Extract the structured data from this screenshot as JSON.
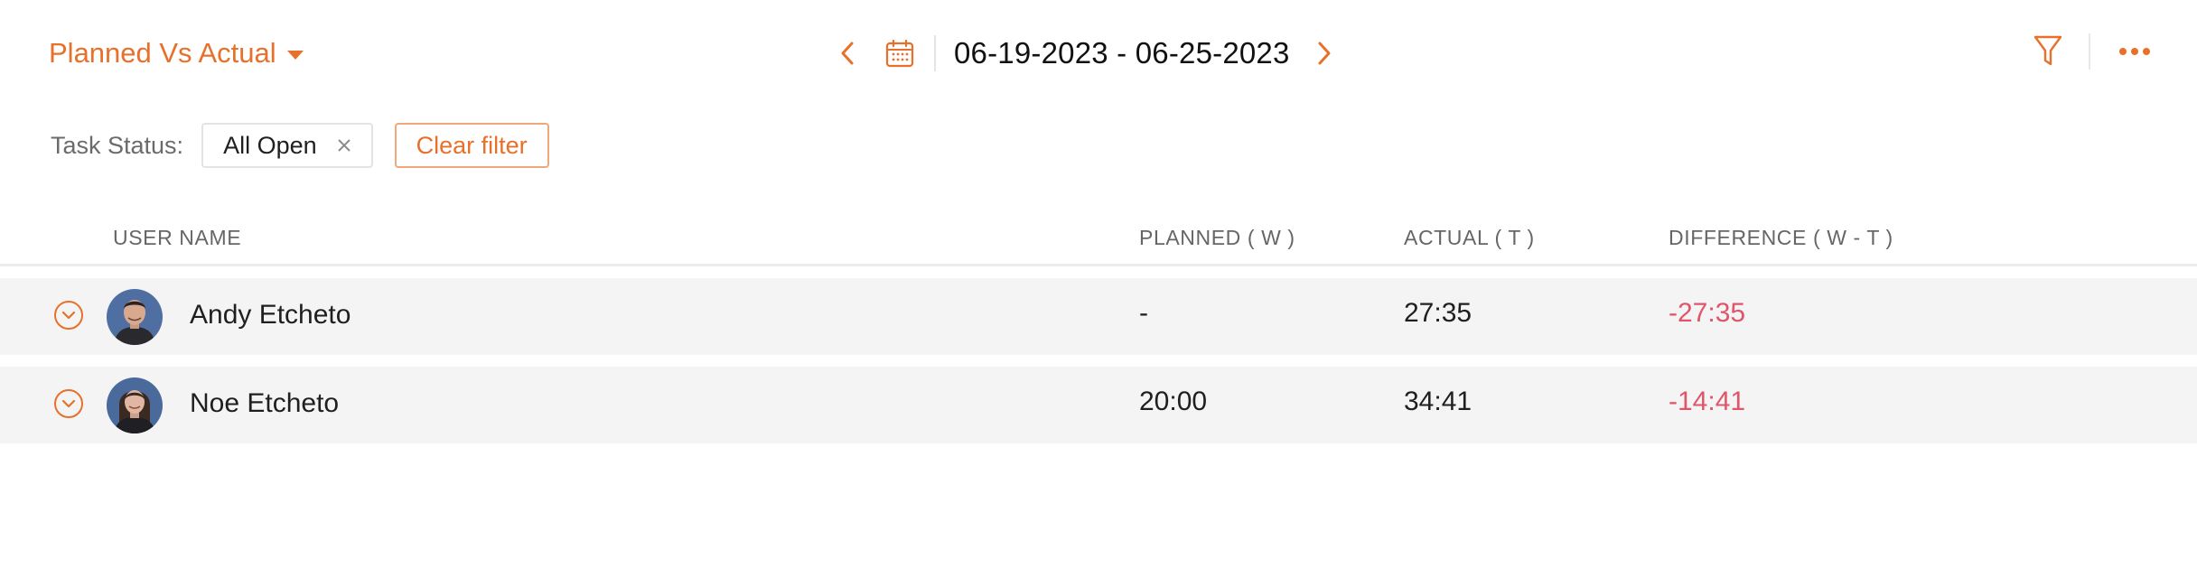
{
  "header": {
    "view_label": "Planned Vs Actual",
    "date_range": "06-19-2023 - 06-25-2023"
  },
  "filters": {
    "label": "Task Status:",
    "chips": [
      {
        "label": "All Open"
      }
    ],
    "clear_label": "Clear filter"
  },
  "table": {
    "columns": {
      "user_name": "USER NAME",
      "planned": "PLANNED ( W )",
      "actual": "ACTUAL ( T )",
      "difference": "DIFFERENCE ( W - T )"
    },
    "rows": [
      {
        "name": "Andy Etcheto",
        "planned": "-",
        "actual": "27:35",
        "difference": "-27:35"
      },
      {
        "name": "Noe Etcheto",
        "planned": "20:00",
        "actual": "34:41",
        "difference": "-14:41"
      }
    ]
  },
  "colors": {
    "accent": "#e8702a",
    "negative": "#e0556a",
    "row_background": "#f4f4f4"
  },
  "icons": {
    "view_caret": "caret-down-icon",
    "prev": "chevron-left-icon",
    "calendar": "calendar-icon",
    "next": "chevron-right-icon",
    "filter": "filter-icon",
    "more": "more-horizontal-icon",
    "chip_remove": "close-icon",
    "row_expand": "chevron-down-circle-icon"
  }
}
